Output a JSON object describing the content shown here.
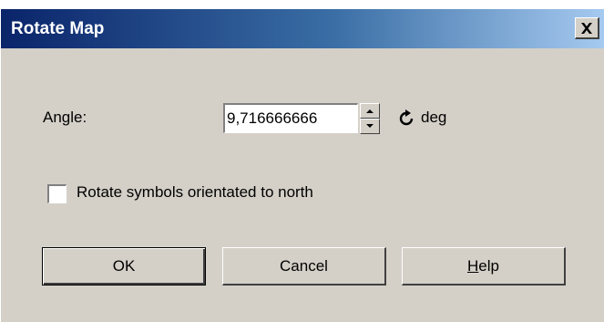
{
  "window": {
    "title": "Rotate Map",
    "close_glyph": "✕"
  },
  "angle": {
    "label": "Angle:",
    "value": "9,716666666",
    "unit": "deg",
    "spin_icons": [
      "spin-up-icon",
      "spin-down-icon"
    ],
    "rotate_icon": "rotate-clockwise-icon"
  },
  "options": {
    "rotate_symbols_label": "Rotate symbols orientated to north",
    "rotate_symbols_checked": false
  },
  "buttons": {
    "ok_label": "OK",
    "cancel_label": "Cancel",
    "help_mnemonic": "H",
    "help_rest": "elp"
  },
  "colors": {
    "title_gradient_start": "#0a246a",
    "title_gradient_end": "#a6caf0",
    "dialog_face": "#d4d0c8"
  }
}
